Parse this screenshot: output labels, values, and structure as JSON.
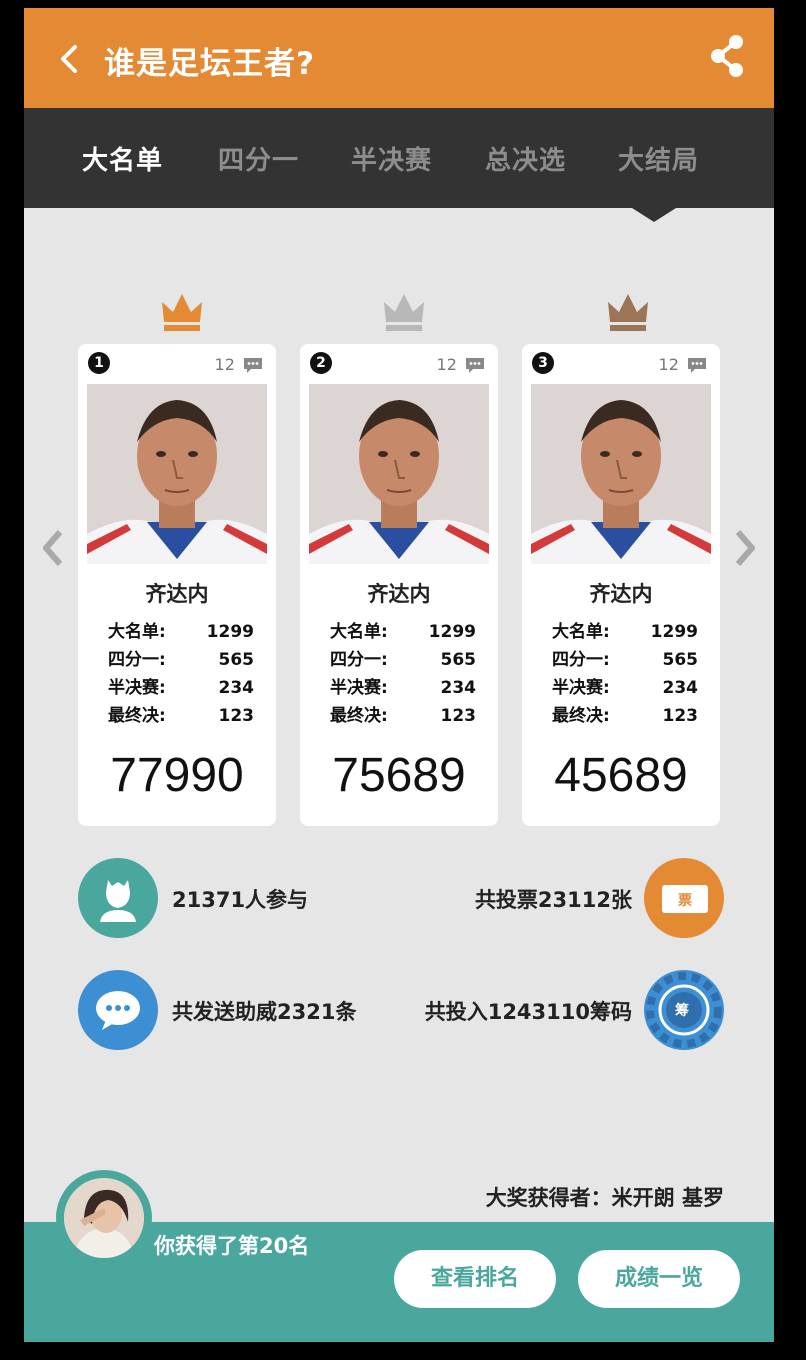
{
  "header": {
    "title": "谁是足坛王者?"
  },
  "tabs": [
    "大名单",
    "四分一",
    "半决赛",
    "总决选",
    "大结局"
  ],
  "cards": [
    {
      "rank": "1",
      "comments": "12",
      "name": "齐达内",
      "stats": [
        {
          "label": "大名单:",
          "value": "1299"
        },
        {
          "label": "四分一:",
          "value": "565"
        },
        {
          "label": "半决赛:",
          "value": "234"
        },
        {
          "label": "最终决:",
          "value": "123"
        }
      ],
      "score": "77990",
      "crown_color": "#e58a34"
    },
    {
      "rank": "2",
      "comments": "12",
      "name": "齐达内",
      "stats": [
        {
          "label": "大名单:",
          "value": "1299"
        },
        {
          "label": "四分一:",
          "value": "565"
        },
        {
          "label": "半决赛:",
          "value": "234"
        },
        {
          "label": "最终决:",
          "value": "123"
        }
      ],
      "score": "75689",
      "crown_color": "#b8b8b8"
    },
    {
      "rank": "3",
      "comments": "12",
      "name": "齐达内",
      "stats": [
        {
          "label": "大名单:",
          "value": "1299"
        },
        {
          "label": "四分一:",
          "value": "565"
        },
        {
          "label": "半决赛:",
          "value": "234"
        },
        {
          "label": "最终决:",
          "value": "123"
        }
      ],
      "score": "45689",
      "crown_color": "#9b7556"
    }
  ],
  "summary": {
    "participants": "21371人参与",
    "votes": "共投票23112张",
    "cheers": "共发送助威2321条",
    "chips": "共投入1243110筹码",
    "vote_icon_text": "票",
    "chip_icon_text": "筹"
  },
  "footer": {
    "winner": "大奖获得者：米开朗 基罗",
    "rank_message": "你获得了第20名",
    "view_ranking": "查看排名",
    "results_overview": "成绩一览"
  },
  "colors": {
    "header": "#e58a34",
    "tabbar": "#333333",
    "teal": "#4aa79e",
    "blue": "#3d8fd4",
    "orange": "#e58a34"
  }
}
